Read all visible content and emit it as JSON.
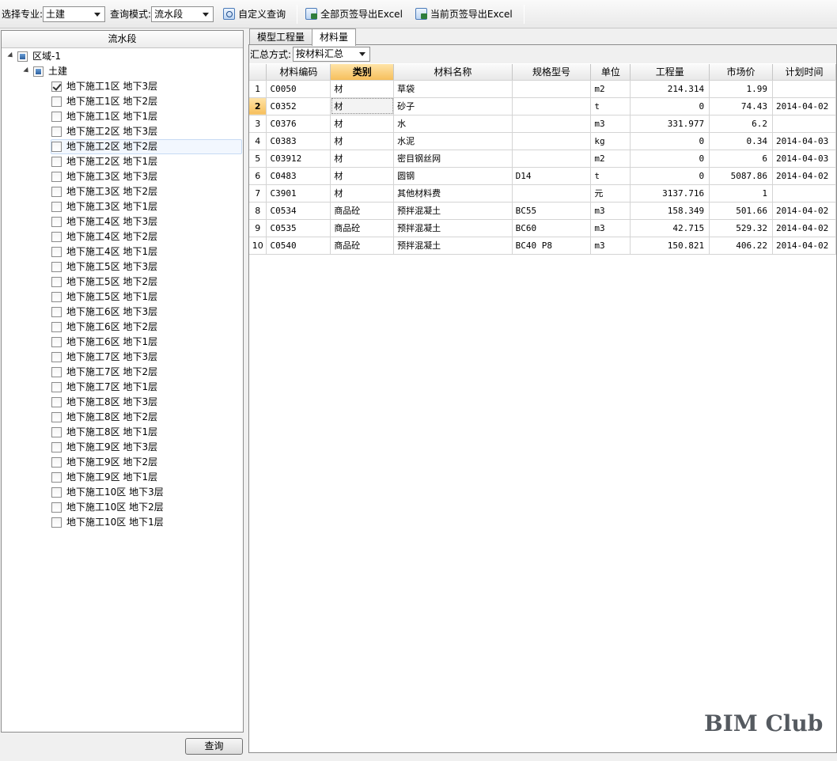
{
  "toolbar": {
    "specialty_label": "选择专业:",
    "specialty_value": "土建",
    "mode_label": "查询模式:",
    "mode_value": "流水段",
    "custom_query": "自定义查询",
    "export_all": "全部页签导出Excel",
    "export_current": "当前页签导出Excel"
  },
  "left_panel": {
    "header": "流水段",
    "root_label": "区域-1",
    "child_label": "土建",
    "items": [
      {
        "label": "地下施工1区 地下3层",
        "checked": true
      },
      {
        "label": "地下施工1区 地下2层",
        "checked": false
      },
      {
        "label": "地下施工1区 地下1层",
        "checked": false
      },
      {
        "label": "地下施工2区 地下3层",
        "checked": false
      },
      {
        "label": "地下施工2区 地下2层",
        "checked": false
      },
      {
        "label": "地下施工2区 地下1层",
        "checked": false
      },
      {
        "label": "地下施工3区 地下3层",
        "checked": false
      },
      {
        "label": "地下施工3区 地下2层",
        "checked": false
      },
      {
        "label": "地下施工3区 地下1层",
        "checked": false
      },
      {
        "label": "地下施工4区 地下3层",
        "checked": false
      },
      {
        "label": "地下施工4区 地下2层",
        "checked": false
      },
      {
        "label": "地下施工4区 地下1层",
        "checked": false
      },
      {
        "label": "地下施工5区 地下3层",
        "checked": false
      },
      {
        "label": "地下施工5区 地下2层",
        "checked": false
      },
      {
        "label": "地下施工5区 地下1层",
        "checked": false
      },
      {
        "label": "地下施工6区 地下3层",
        "checked": false
      },
      {
        "label": "地下施工6区 地下2层",
        "checked": false
      },
      {
        "label": "地下施工6区 地下1层",
        "checked": false
      },
      {
        "label": "地下施工7区 地下3层",
        "checked": false
      },
      {
        "label": "地下施工7区 地下2层",
        "checked": false
      },
      {
        "label": "地下施工7区 地下1层",
        "checked": false
      },
      {
        "label": "地下施工8区 地下3层",
        "checked": false
      },
      {
        "label": "地下施工8区 地下2层",
        "checked": false
      },
      {
        "label": "地下施工8区 地下1层",
        "checked": false
      },
      {
        "label": "地下施工9区 地下3层",
        "checked": false
      },
      {
        "label": "地下施工9区 地下2层",
        "checked": false
      },
      {
        "label": "地下施工9区 地下1层",
        "checked": false
      },
      {
        "label": "地下施工10区 地下3层",
        "checked": false
      },
      {
        "label": "地下施工10区 地下2层",
        "checked": false
      },
      {
        "label": "地下施工10区 地下1层",
        "checked": false
      }
    ],
    "highlighted_item": "地下施工2区 地下2层",
    "query_button": "查询"
  },
  "tabs": [
    {
      "label": "模型工程量",
      "active": false
    },
    {
      "label": "材料量",
      "active": true
    }
  ],
  "summary": {
    "label": "汇总方式:",
    "value": "按材料汇总"
  },
  "table": {
    "columns": [
      "材料编码",
      "类别",
      "材料名称",
      "规格型号",
      "单位",
      "工程量",
      "市场价",
      "计划时间"
    ],
    "active_column": "类别",
    "current_row": 2,
    "rows": [
      {
        "no": "1",
        "code": "C0050",
        "category": "材",
        "name": "草袋",
        "spec": "",
        "unit": "m2",
        "qty": "214.314",
        "price": "1.99",
        "date": ""
      },
      {
        "no": "2",
        "code": "C0352",
        "category": "材",
        "name": "砂子",
        "spec": "",
        "unit": "t",
        "qty": "0",
        "price": "74.43",
        "date": "2014-04-02"
      },
      {
        "no": "3",
        "code": "C0376",
        "category": "材",
        "name": "水",
        "spec": "",
        "unit": "m3",
        "qty": "331.977",
        "price": "6.2",
        "date": ""
      },
      {
        "no": "4",
        "code": "C0383",
        "category": "材",
        "name": "水泥",
        "spec": "",
        "unit": "kg",
        "qty": "0",
        "price": "0.34",
        "date": "2014-04-03"
      },
      {
        "no": "5",
        "code": "C03912",
        "category": "材",
        "name": "密目钢丝网",
        "spec": "",
        "unit": "m2",
        "qty": "0",
        "price": "6",
        "date": "2014-04-03"
      },
      {
        "no": "6",
        "code": "C0483",
        "category": "材",
        "name": "圆钢",
        "spec": "D14",
        "unit": "t",
        "qty": "0",
        "price": "5087.86",
        "date": "2014-04-02"
      },
      {
        "no": "7",
        "code": "C3901",
        "category": "材",
        "name": "其他材料费",
        "spec": "",
        "unit": "元",
        "qty": "3137.716",
        "price": "1",
        "date": ""
      },
      {
        "no": "8",
        "code": "C0534",
        "category": "商品砼",
        "name": "预拌混凝土",
        "spec": "BC55",
        "unit": "m3",
        "qty": "158.349",
        "price": "501.66",
        "date": "2014-04-02"
      },
      {
        "no": "9",
        "code": "C0535",
        "category": "商品砼",
        "name": "预拌混凝土",
        "spec": "BC60",
        "unit": "m3",
        "qty": "42.715",
        "price": "529.32",
        "date": "2014-04-02"
      },
      {
        "no": "10",
        "code": "C0540",
        "category": "商品砼",
        "name": "预拌混凝土",
        "spec": "BC40 P8",
        "unit": "m3",
        "qty": "150.821",
        "price": "406.22",
        "date": "2014-04-02"
      }
    ]
  },
  "watermark": "BIM Club",
  "icons": {
    "custom_query": "query-icon",
    "export_all": "excel-export-icon",
    "export_current": "excel-export-icon"
  }
}
